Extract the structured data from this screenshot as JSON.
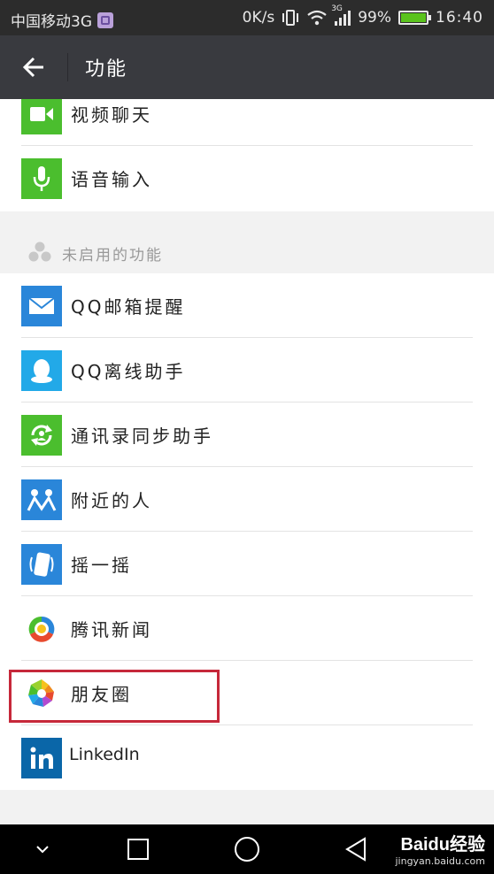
{
  "status_bar": {
    "carrier": "中国移动3G",
    "speed": "0K/s",
    "network": "3G",
    "battery": "99%",
    "time": "16:40"
  },
  "app_bar": {
    "title": "功能"
  },
  "enabled_items": [
    {
      "label": "视频聊天",
      "icon": "video-icon",
      "color": "#4bbe2e"
    },
    {
      "label": "语音输入",
      "icon": "mic-icon",
      "color": "#4bbe2e"
    }
  ],
  "disabled_section": {
    "header": "未启用的功能",
    "items": [
      {
        "label": "QQ邮箱提醒",
        "icon": "mail-icon",
        "color": "#2a86d9"
      },
      {
        "label": "QQ离线助手",
        "icon": "qq-penguin-icon",
        "color": "#22a9e8"
      },
      {
        "label": "通讯录同步助手",
        "icon": "sync-icon",
        "color": "#4bbe2e"
      },
      {
        "label": "附近的人",
        "icon": "people-nearby-icon",
        "color": "#2a86d9"
      },
      {
        "label": "摇一摇",
        "icon": "shake-icon",
        "color": "#2a86d9"
      },
      {
        "label": "腾讯新闻",
        "icon": "tencent-news-icon",
        "color": "#ffffff"
      },
      {
        "label": "朋友圈",
        "icon": "moments-icon",
        "color": "#ffffff"
      },
      {
        "label": "LinkedIn",
        "icon": "linkedin-icon",
        "color": "#0a66a8"
      }
    ]
  },
  "watermark": {
    "brand": "Baidu经验",
    "url": "jingyan.baidu.com"
  },
  "colors": {
    "highlight": "#c6283a",
    "app_bar": "#393a3f",
    "status_bar": "#2c2c2c"
  }
}
